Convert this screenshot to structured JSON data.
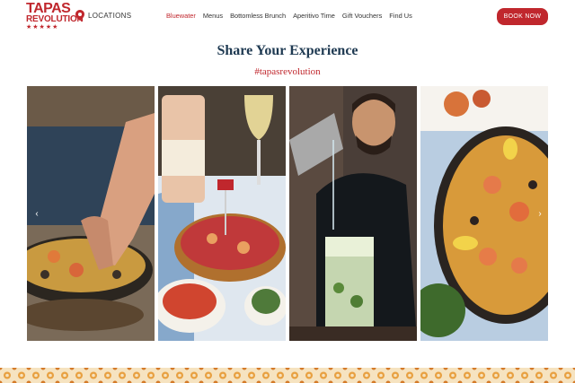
{
  "brand": {
    "logo_line1": "TAPAS",
    "logo_line2": "REVOLUTION",
    "logo_stars": "★★★★★",
    "accent_color": "#c0272d"
  },
  "header": {
    "locations_label": "LOCATIONS",
    "nav": [
      {
        "label": "Bluewater",
        "active": true
      },
      {
        "label": "Menus"
      },
      {
        "label": "Bottomless Brunch"
      },
      {
        "label": "Aperitivo Time"
      },
      {
        "label": "Gift Vouchers"
      },
      {
        "label": "Find Us"
      }
    ],
    "book_label": "BOOK NOW"
  },
  "main": {
    "title": "Share Your Experience",
    "hashtag": "#tapasrevolution"
  },
  "gallery": {
    "images": [
      {
        "name": "paella-hand-photo"
      },
      {
        "name": "tapas-table-photo"
      },
      {
        "name": "bartender-photo"
      },
      {
        "name": "paella-overhead-photo"
      }
    ],
    "prev_icon": "chevron-left-icon",
    "next_icon": "chevron-right-icon"
  }
}
